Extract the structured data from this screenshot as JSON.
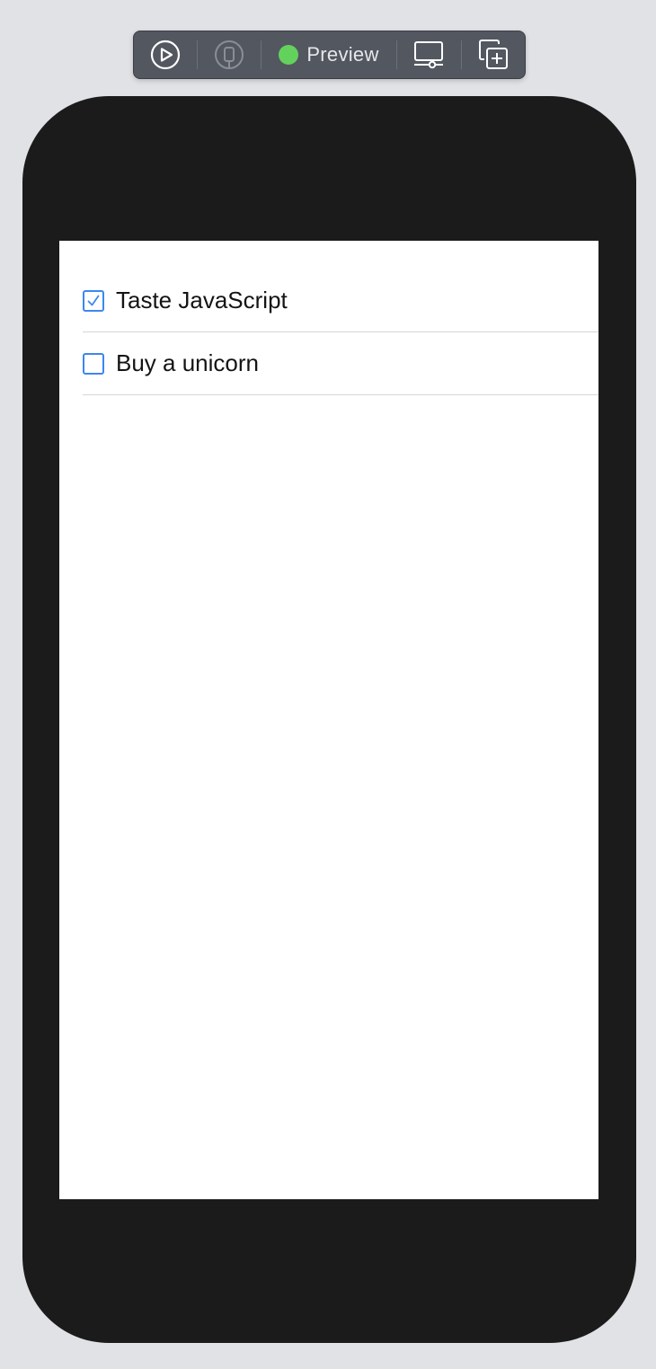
{
  "toolbar": {
    "buttons": [
      {
        "name": "live-preview",
        "icon": "play-circle-icon"
      },
      {
        "name": "device-preview",
        "icon": "device-icon"
      },
      {
        "name": "display-settings",
        "icon": "display-icon"
      },
      {
        "name": "duplicate-preview",
        "icon": "duplicate-icon"
      }
    ],
    "preview_label": "Preview",
    "status_color": "#63d25d"
  },
  "colors": {
    "checkbox_accent": "#3d86f0",
    "device_frame": "#1b1b1b",
    "background": "#e1e2e6"
  },
  "todos": [
    {
      "label": "Taste JavaScript",
      "checked": true
    },
    {
      "label": "Buy a unicorn",
      "checked": false
    }
  ]
}
